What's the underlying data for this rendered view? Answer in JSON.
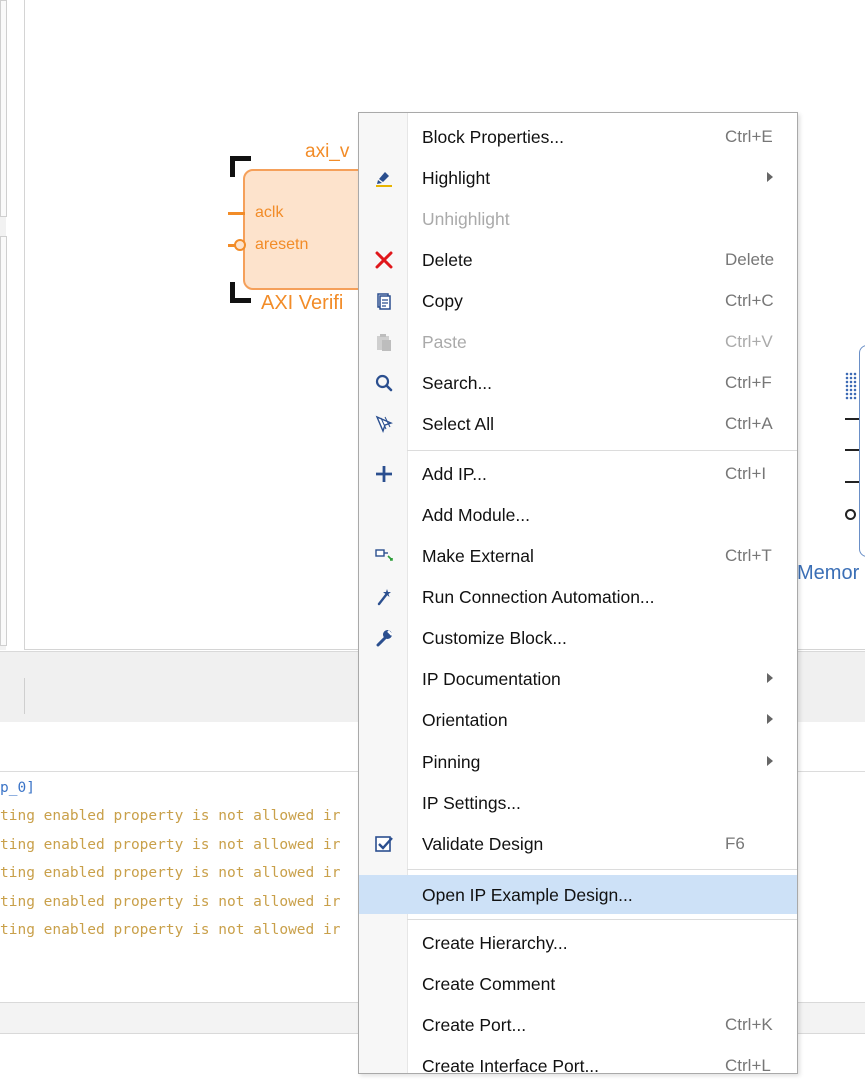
{
  "diagram": {
    "ip_block": {
      "instance_name": "axi_v",
      "subtitle": "AXI Verifi",
      "pins": [
        "aclk",
        "aresetn"
      ]
    },
    "memory_block": {
      "label": "Memor"
    }
  },
  "log": {
    "header_fragment": "p_0]",
    "lines": [
      "ting enabled property is not allowed ir",
      "ting enabled property is not allowed ir",
      "ting enabled property is not allowed ir",
      "ting enabled property is not allowed ir",
      "ting enabled property is not allowed ir"
    ]
  },
  "context_menu": {
    "items": [
      {
        "label": "Block Properties...",
        "shortcut": "Ctrl+E",
        "icon": "none"
      },
      {
        "label": "Highlight",
        "shortcut": "",
        "icon": "highlight-icon",
        "submenu": true
      },
      {
        "label": "Unhighlight",
        "shortcut": "",
        "icon": "none",
        "disabled": true
      },
      {
        "label": "Delete",
        "shortcut": "Delete",
        "icon": "delete-x-icon"
      },
      {
        "label": "Copy",
        "shortcut": "Ctrl+C",
        "icon": "copy-icon"
      },
      {
        "label": "Paste",
        "shortcut": "Ctrl+V",
        "icon": "paste-icon",
        "disabled": true
      },
      {
        "label": "Search...",
        "shortcut": "Ctrl+F",
        "icon": "search-icon"
      },
      {
        "label": "Select All",
        "shortcut": "Ctrl+A",
        "icon": "select-all-icon"
      },
      {
        "label": "Add IP...",
        "shortcut": "Ctrl+I",
        "icon": "plus-icon"
      },
      {
        "label": "Add Module...",
        "shortcut": "",
        "icon": "none"
      },
      {
        "label": "Make External",
        "shortcut": "Ctrl+T",
        "icon": "make-external-icon"
      },
      {
        "label": "Run Connection Automation...",
        "shortcut": "",
        "icon": "wand-icon"
      },
      {
        "label": "Customize Block...",
        "shortcut": "",
        "icon": "wrench-icon"
      },
      {
        "label": "IP Documentation",
        "shortcut": "",
        "icon": "none",
        "submenu": true
      },
      {
        "label": "Orientation",
        "shortcut": "",
        "icon": "none",
        "submenu": true
      },
      {
        "label": "Pinning",
        "shortcut": "",
        "icon": "none",
        "submenu": true
      },
      {
        "label": "IP Settings...",
        "shortcut": "",
        "icon": "none"
      },
      {
        "label": "Validate Design",
        "shortcut": "F6",
        "icon": "validate-icon"
      },
      {
        "label": "Open IP Example Design...",
        "shortcut": "",
        "icon": "none",
        "highlighted": true
      },
      {
        "label": "Create Hierarchy...",
        "shortcut": "",
        "icon": "none"
      },
      {
        "label": "Create Comment",
        "shortcut": "",
        "icon": "none"
      },
      {
        "label": "Create Port...",
        "shortcut": "Ctrl+K",
        "icon": "none"
      },
      {
        "label": "Create Interface Port...",
        "shortcut": "Ctrl+L",
        "icon": "none"
      }
    ]
  },
  "colors": {
    "ip_orange": "#f28c28",
    "menu_highlight": "#cde1f7",
    "memory_blue": "#3b6fb6",
    "log_warning": "#c9a04a"
  }
}
